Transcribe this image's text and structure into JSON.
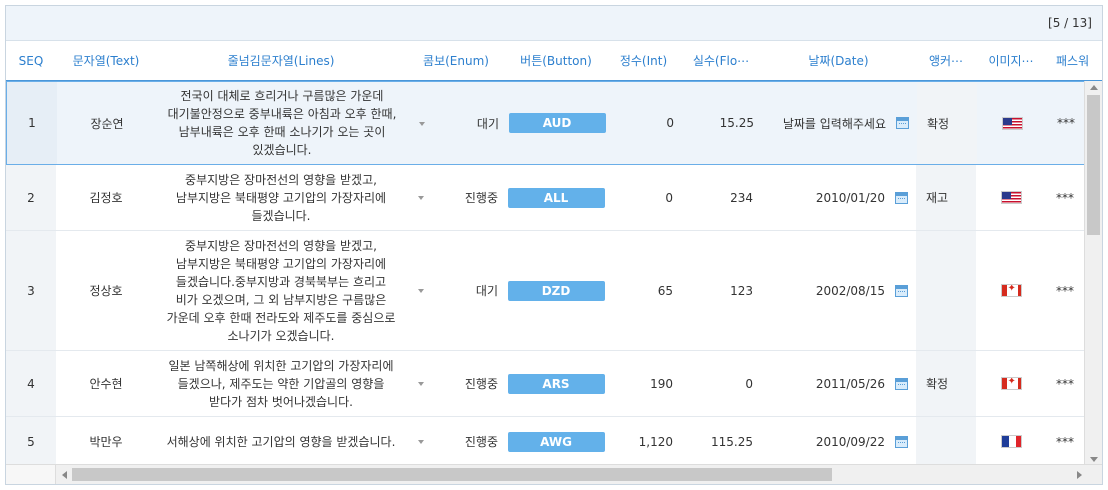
{
  "pager": {
    "text": "[5 / 13]"
  },
  "columns": {
    "seq": "SEQ",
    "text": "문자열(Text)",
    "lines": "줄넘김문자열(Lines)",
    "enum": "콤보(Enum)",
    "button": "버튼(Button)",
    "int": "정수(Int)",
    "float": "실수(Flo⋯",
    "date": "날짜(Date)",
    "anchor": "앵커⋯",
    "image": "이미지⋯",
    "password": "패스워"
  },
  "rows": [
    {
      "seq": "1",
      "text": "장순연",
      "lines": "전국이 대체로 흐리거나 구름많은 가운데 대기불안정으로 중부내륙은 아침과 오후 한때, 남부내륙은 오후 한때 소나기가 오는 곳이 있겠습니다.",
      "enum": "대기",
      "button": "AUD",
      "int": "0",
      "float": "15.25",
      "date": "날짜를 입력해주세요",
      "anchor": "확정",
      "flag": "us",
      "password": "***"
    },
    {
      "seq": "2",
      "text": "김정호",
      "lines": "중부지방은 장마전선의 영향을 받겠고, 남부지방은 북태평양 고기압의 가장자리에 들겠습니다.",
      "enum": "진행중",
      "button": "ALL",
      "int": "0",
      "float": "234",
      "date": "2010/01/20",
      "anchor": "재고",
      "flag": "us",
      "password": "***"
    },
    {
      "seq": "3",
      "text": "정상호",
      "lines": "중부지방은 장마전선의 영향을 받겠고, 남부지방은 북태평양 고기압의 가장자리에 들겠습니다.중부지방과 경북북부는 흐리고 비가 오겠으며, 그 외 남부지방은 구름많은 가운데 오후 한때 전라도와 제주도를 중심으로 소나기가 오겠습니다.",
      "enum": "대기",
      "button": "DZD",
      "int": "65",
      "float": "123",
      "date": "2002/08/15",
      "anchor": "",
      "flag": "ca",
      "password": "***"
    },
    {
      "seq": "4",
      "text": "안수현",
      "lines": "일본 남쪽해상에 위치한 고기압의 가장자리에 들겠으나, 제주도는 약한 기압골의 영향을 받다가 점차 벗어나겠습니다.",
      "enum": "진행중",
      "button": "ARS",
      "int": "190",
      "float": "0",
      "date": "2011/05/26",
      "anchor": "확정",
      "flag": "ca",
      "password": "***"
    },
    {
      "seq": "5",
      "text": "박만우",
      "lines": "서해상에 위치한 고기압의 영향을 받겠습니다.",
      "enum": "진행중",
      "button": "AWG",
      "int": "1,120",
      "float": "115.25",
      "date": "2010/09/22",
      "anchor": "",
      "flag": "fr",
      "password": "***"
    }
  ]
}
